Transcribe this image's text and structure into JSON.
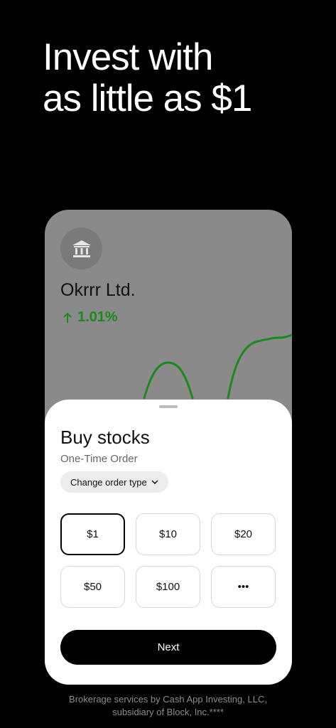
{
  "headline": {
    "line1": "Invest with",
    "line2": "as little as $1"
  },
  "stock": {
    "name": "Okrrr Ltd.",
    "change": "1.01%"
  },
  "sheet": {
    "title": "Buy stocks",
    "subtitle": "One-Time Order",
    "order_type_label": "Change order type",
    "amounts": [
      "$1",
      "$10",
      "$20",
      "$50",
      "$100",
      "•••"
    ],
    "selected_amount": "$1",
    "next_label": "Next"
  },
  "footer": {
    "line1": "Brokerage services by Cash App Investing, LLC,",
    "line2": "subsidiary of Block, Inc.****"
  },
  "colors": {
    "positive": "#1a8a1a",
    "card_bg": "#8a8a8a",
    "accent": "#000000"
  },
  "icons": [
    "bank-icon",
    "arrow-up-icon",
    "chevron-down-icon",
    "more-icon"
  ]
}
